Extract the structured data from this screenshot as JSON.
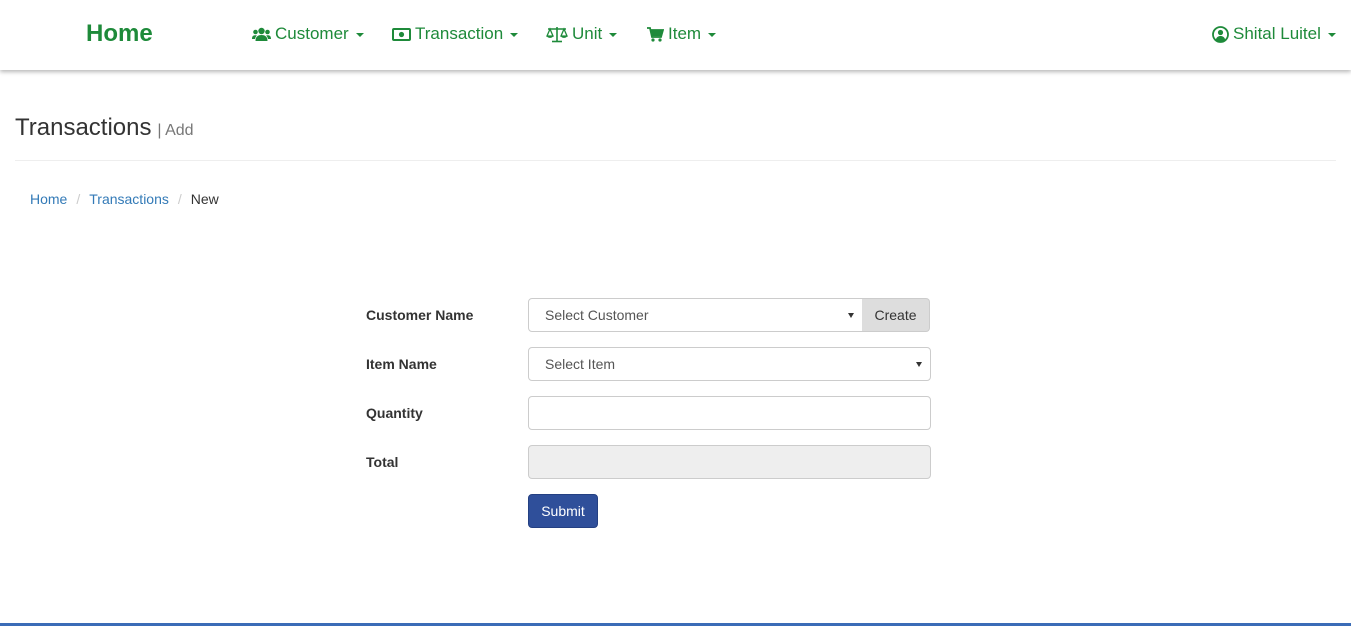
{
  "navbar": {
    "brand": "Home",
    "items": [
      {
        "label": "Customer",
        "icon": "users-icon"
      },
      {
        "label": "Transaction",
        "icon": "money-icon"
      },
      {
        "label": "Unit",
        "icon": "balance-scale-icon"
      },
      {
        "label": "Item",
        "icon": "cart-icon"
      }
    ],
    "user": {
      "label": "Shital Luitel",
      "icon": "user-circle-icon"
    }
  },
  "page": {
    "title": "Transactions",
    "subtitle": "| Add"
  },
  "breadcrumb": [
    "Home",
    "Transactions",
    "New"
  ],
  "form": {
    "customer": {
      "label": "Customer Name",
      "selected": "Select Customer",
      "addon": "Create"
    },
    "item": {
      "label": "Item Name",
      "selected": "Select Item"
    },
    "quantity": {
      "label": "Quantity",
      "value": ""
    },
    "total": {
      "label": "Total",
      "value": ""
    },
    "submit": "Submit"
  },
  "colors": {
    "brand_green": "#1e8a3a",
    "link_blue": "#337ab7",
    "primary_button": "#2f4f9a",
    "footer_bar": "#3b6cb7"
  }
}
